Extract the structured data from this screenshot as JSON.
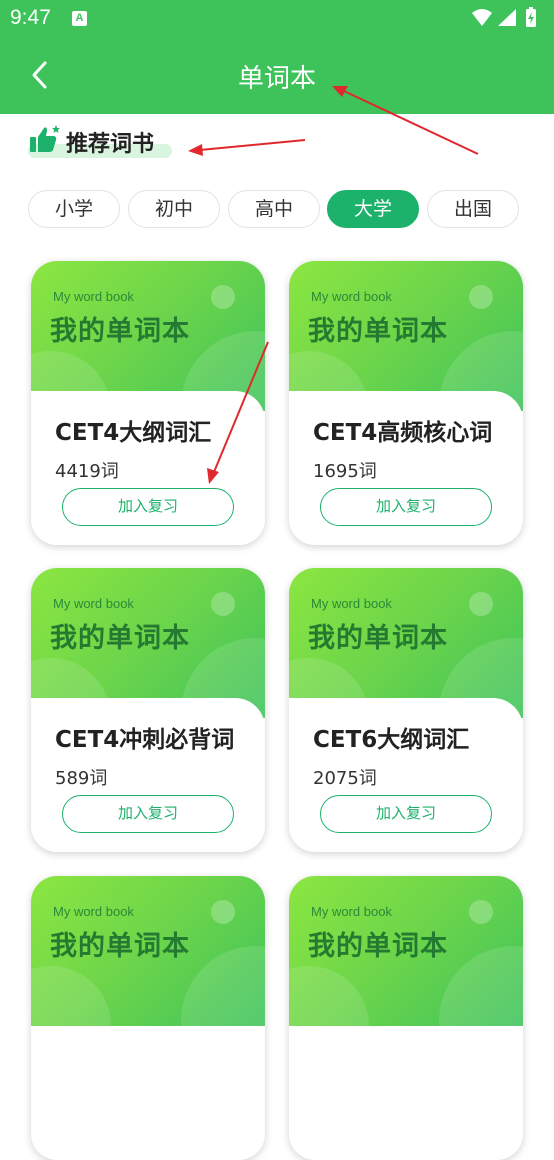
{
  "status_bar": {
    "time": "9:47",
    "app_indicator": "A"
  },
  "app_bar": {
    "title": "单词本",
    "back_icon": "chevron-left-icon"
  },
  "section": {
    "title": "推荐词书",
    "icon": "thumbs-up-icon"
  },
  "tabs": [
    {
      "label": "小学",
      "active": false
    },
    {
      "label": "初中",
      "active": false
    },
    {
      "label": "高中",
      "active": false
    },
    {
      "label": "大学",
      "active": true
    },
    {
      "label": "出国",
      "active": false
    }
  ],
  "cover": {
    "subtitle": "My word book",
    "title": "我的单词本"
  },
  "books": [
    {
      "name": "CET4大纲词汇",
      "count": "4419词",
      "button": "加入复习"
    },
    {
      "name": "CET4高频核心词",
      "count": "1695词",
      "button": "加入复习"
    },
    {
      "name": "CET4冲刺必背词",
      "count": "589词",
      "button": "加入复习"
    },
    {
      "name": "CET6大纲词汇",
      "count": "2075词",
      "button": "加入复习"
    },
    {
      "name": "",
      "count": "",
      "button": ""
    },
    {
      "name": "",
      "count": "",
      "button": ""
    }
  ],
  "colors": {
    "primary": "#3ec35b",
    "accent": "#1db26b",
    "annotation": "#e0282e"
  }
}
